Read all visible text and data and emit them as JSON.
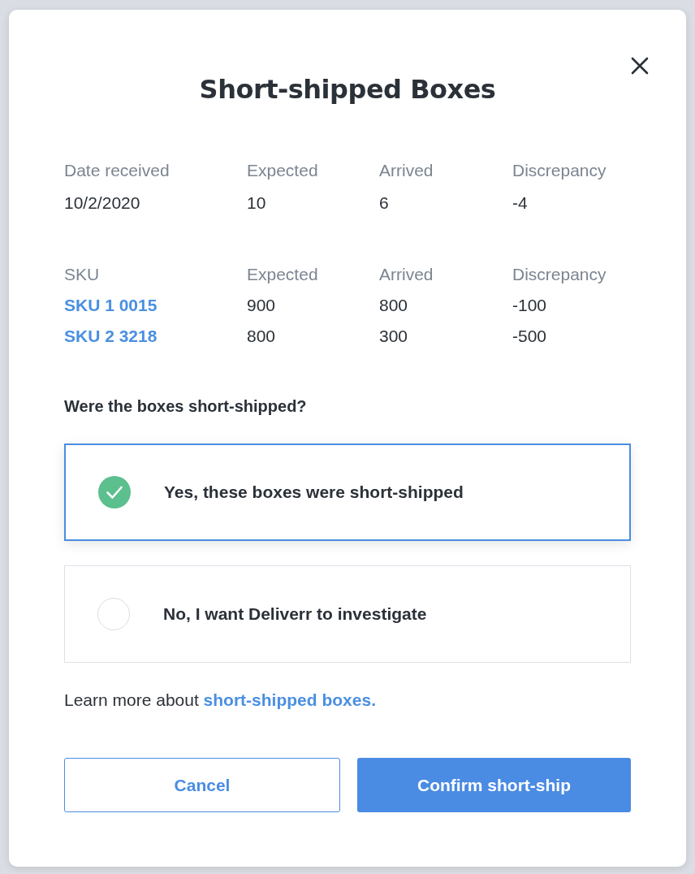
{
  "dialog": {
    "title": "Short-shipped Boxes"
  },
  "summary": {
    "columns": [
      "Date received",
      "Expected",
      "Arrived",
      "Discrepancy"
    ],
    "values": [
      "10/2/2020",
      "10",
      "6",
      "-4"
    ]
  },
  "sku_table": {
    "columns": [
      "SKU",
      "Expected",
      "Arrived",
      "Discrepancy"
    ],
    "rows": [
      {
        "sku": "SKU 1 0015",
        "expected": "900",
        "arrived": "800",
        "discrepancy": "-100"
      },
      {
        "sku": "SKU 2 3218",
        "expected": "800",
        "arrived": "300",
        "discrepancy": "-500"
      }
    ]
  },
  "question": "Were the boxes short-shipped?",
  "options": [
    {
      "label": "Yes, these boxes were short-shipped",
      "selected": true
    },
    {
      "label": "No, I want Deliverr to investigate",
      "selected": false
    }
  ],
  "learn_more": {
    "text": "Learn more about",
    "link": "short-shipped boxes."
  },
  "buttons": [
    {
      "label": "Cancel",
      "kind": "secondary"
    },
    {
      "label": "Confirm short-ship",
      "kind": "primary"
    }
  ]
}
